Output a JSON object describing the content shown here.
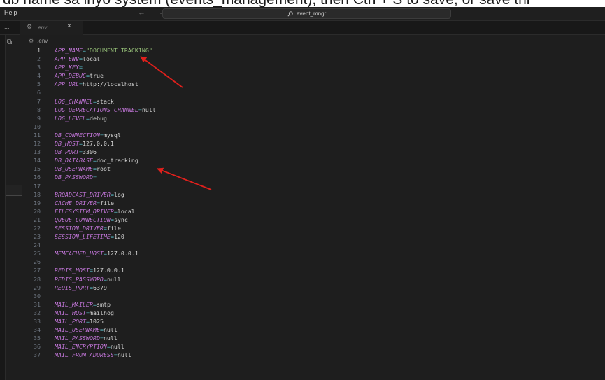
{
  "caption": {
    "text": "db name sa inyo system (events_management), then Ctrl + S to save, or save thi"
  },
  "titlebar": {
    "menu_help": "Help",
    "nav_arrows": "← →",
    "command_center": "event_mngr"
  },
  "tabbar": {
    "ellipsis": "...",
    "tab_label": ".env",
    "close_glyph": "×"
  },
  "breadcrumb": {
    "file": ".env"
  },
  "editor": {
    "active_line": 1,
    "lines": [
      {
        "n": "1",
        "key": "APP_NAME",
        "value": "\"DOCUMENT TRACKING\""
      },
      {
        "n": "2",
        "key": "APP_ENV",
        "value": "local"
      },
      {
        "n": "3",
        "key": "APP_KEY",
        "value": ""
      },
      {
        "n": "4",
        "key": "APP_DEBUG",
        "value": "true"
      },
      {
        "n": "5",
        "key": "APP_URL",
        "value": "http://localhost"
      },
      {
        "n": "6",
        "key": "",
        "value": ""
      },
      {
        "n": "7",
        "key": "LOG_CHANNEL",
        "value": "stack"
      },
      {
        "n": "8",
        "key": "LOG_DEPRECATIONS_CHANNEL",
        "value": "null"
      },
      {
        "n": "9",
        "key": "LOG_LEVEL",
        "value": "debug"
      },
      {
        "n": "10",
        "key": "",
        "value": ""
      },
      {
        "n": "11",
        "key": "DB_CONNECTION",
        "value": "mysql"
      },
      {
        "n": "12",
        "key": "DB_HOST",
        "value": "127.0.0.1"
      },
      {
        "n": "13",
        "key": "DB_PORT",
        "value": "3306"
      },
      {
        "n": "14",
        "key": "DB_DATABASE",
        "value": "doc_tracking"
      },
      {
        "n": "15",
        "key": "DB_USERNAME",
        "value": "root"
      },
      {
        "n": "16",
        "key": "DB_PASSWORD",
        "value": ""
      },
      {
        "n": "17",
        "key": "",
        "value": ""
      },
      {
        "n": "18",
        "key": "BROADCAST_DRIVER",
        "value": "log"
      },
      {
        "n": "19",
        "key": "CACHE_DRIVER",
        "value": "file"
      },
      {
        "n": "20",
        "key": "FILESYSTEM_DRIVER",
        "value": "local"
      },
      {
        "n": "21",
        "key": "QUEUE_CONNECTION",
        "value": "sync"
      },
      {
        "n": "22",
        "key": "SESSION_DRIVER",
        "value": "file"
      },
      {
        "n": "23",
        "key": "SESSION_LIFETIME",
        "value": "120"
      },
      {
        "n": "24",
        "key": "",
        "value": ""
      },
      {
        "n": "25",
        "key": "MEMCACHED_HOST",
        "value": "127.0.0.1"
      },
      {
        "n": "26",
        "key": "",
        "value": ""
      },
      {
        "n": "27",
        "key": "REDIS_HOST",
        "value": "127.0.0.1"
      },
      {
        "n": "28",
        "key": "REDIS_PASSWORD",
        "value": "null"
      },
      {
        "n": "29",
        "key": "REDIS_PORT",
        "value": "6379"
      },
      {
        "n": "30",
        "key": "",
        "value": ""
      },
      {
        "n": "31",
        "key": "MAIL_MAILER",
        "value": "smtp"
      },
      {
        "n": "32",
        "key": "MAIL_HOST",
        "value": "mailhog"
      },
      {
        "n": "33",
        "key": "MAIL_PORT",
        "value": "1025"
      },
      {
        "n": "34",
        "key": "MAIL_USERNAME",
        "value": "null"
      },
      {
        "n": "35",
        "key": "MAIL_PASSWORD",
        "value": "null"
      },
      {
        "n": "36",
        "key": "MAIL_ENCRYPTION",
        "value": "null"
      },
      {
        "n": "37",
        "key": "MAIL_FROM_ADDRESS",
        "value": "null"
      }
    ]
  },
  "colors": {
    "editor_bg": "#1e1e1e",
    "env_key": "#c678dd",
    "string_value": "#98c379",
    "annotation_arrow": "#e0201c"
  }
}
